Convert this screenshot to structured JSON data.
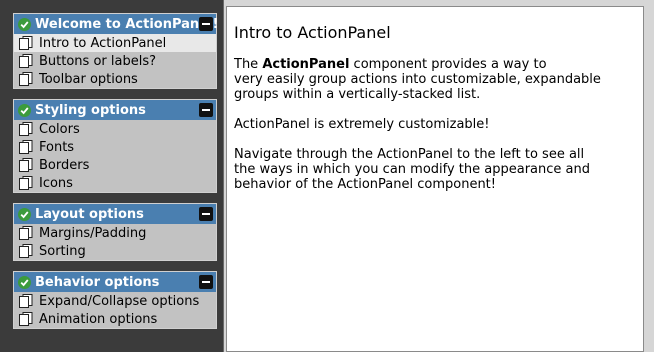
{
  "sidebar": {
    "groups": [
      {
        "title": "Welcome to ActionPanel!",
        "items": [
          "Intro to ActionPanel",
          "Buttons or labels?",
          "Toolbar options"
        ]
      },
      {
        "title": "Styling options",
        "items": [
          "Colors",
          "Fonts",
          "Borders",
          "Icons"
        ]
      },
      {
        "title": "Layout options",
        "items": [
          "Margins/Padding",
          "Sorting"
        ]
      },
      {
        "title": "Behavior options",
        "items": [
          "Expand/Collapse options",
          "Animation options"
        ]
      }
    ]
  },
  "content": {
    "heading": "Intro to ActionPanel",
    "p1_pre": "The ",
    "p1_bold": "ActionPanel",
    "p1_post_line1": " component provides a way to",
    "p1_line2": "very easily group actions into customizable, expandable",
    "p1_line3": "groups within a vertically-stacked list.",
    "p2": "ActionPanel is extremely customizable!",
    "p3_line1": "Navigate through the ActionPanel to the left to see all",
    "p3_line2": "the ways in which you can modify the appearance and",
    "p3_line3": "behavior of the ActionPanel component!"
  },
  "colors": {
    "header": "#4a7fb0",
    "panel": "#c2c2c2",
    "sidebar_bg": "#3b3b3b",
    "selected_item": "#e8e8e8",
    "check": "#3c9b3c"
  },
  "icons": {
    "group_header": "check-circle-icon",
    "collapse": "minus-icon",
    "item": "pages-icon"
  }
}
